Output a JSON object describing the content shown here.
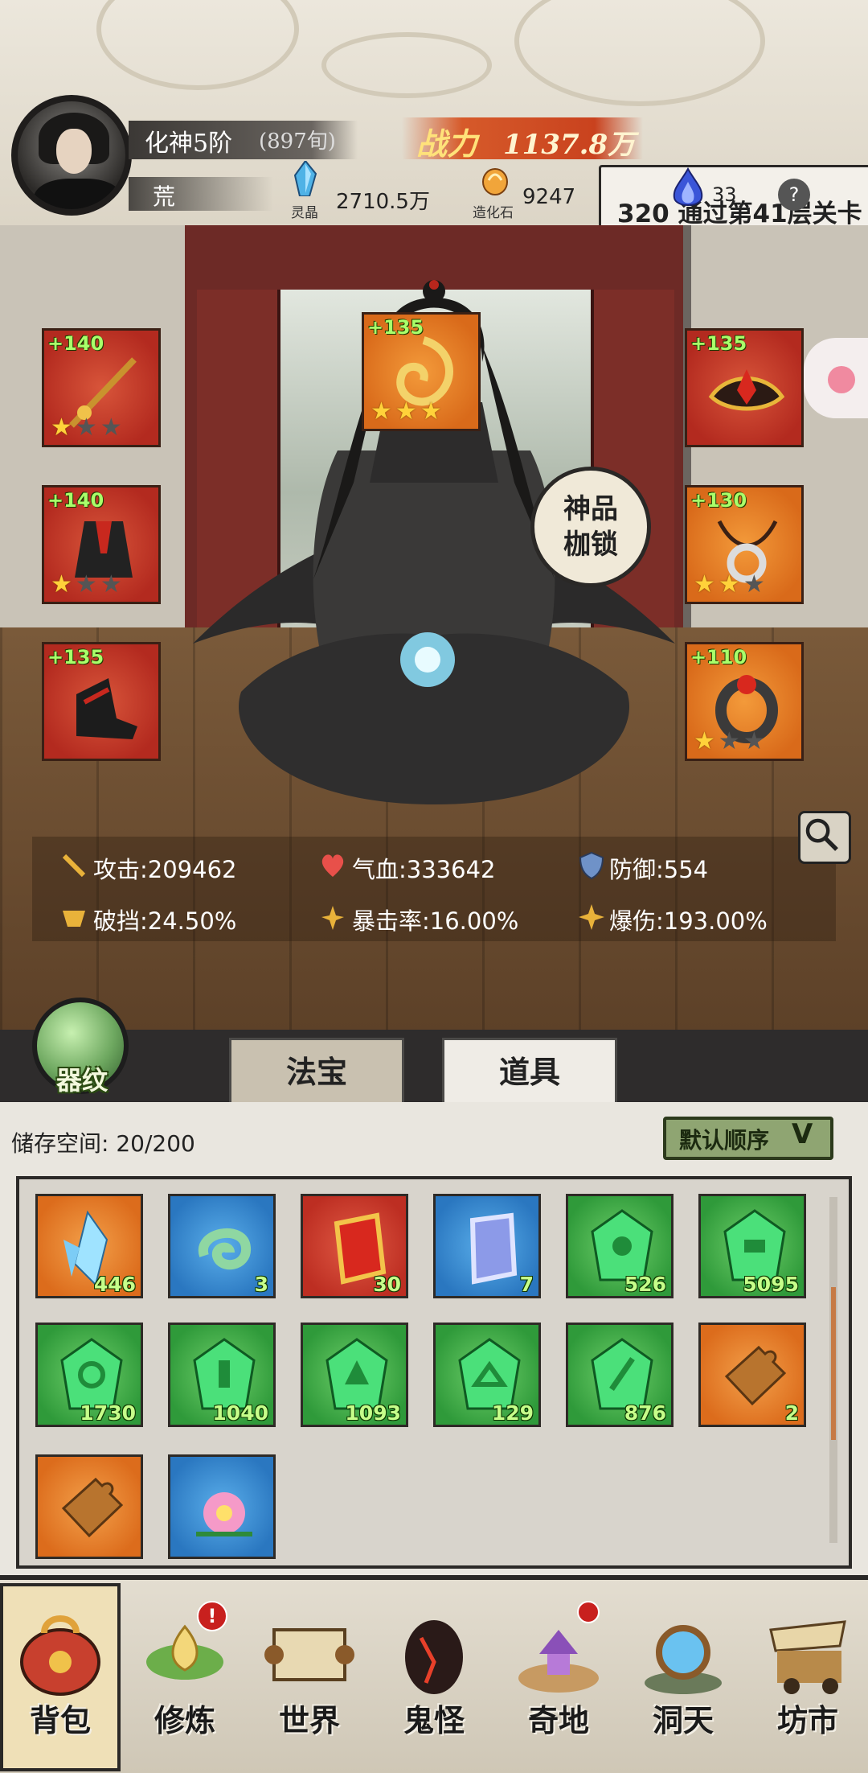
{
  "header": {
    "rank": "化神5阶",
    "rank_sub": "(897旬)",
    "realm": "荒",
    "power_label": "战力",
    "power_value": "1137.8万",
    "currencies": [
      {
        "icon": "spirit-crystal-icon",
        "label": "灵晶",
        "value": "2710.5万"
      },
      {
        "icon": "creation-stone-icon",
        "label": "造化石",
        "value": "9247"
      }
    ],
    "quest": {
      "drop_count": "33",
      "text": "320 通过第41层关卡",
      "bubble": "?"
    }
  },
  "scene": {
    "badge_line1": "神品",
    "badge_line2": "枷锁",
    "equipment": [
      {
        "name": "sword",
        "plus": "+140",
        "stars": 1,
        "max_stars": 3
      },
      {
        "name": "armor",
        "plus": "+140",
        "stars": 1,
        "max_stars": 3
      },
      {
        "name": "boots",
        "plus": "+135",
        "stars": 0,
        "max_stars": 3
      },
      {
        "name": "golden-relic",
        "plus": "+135",
        "stars": 3,
        "max_stars": 3
      },
      {
        "name": "crown",
        "plus": "+135",
        "stars": 0,
        "max_stars": 3
      },
      {
        "name": "pendant",
        "plus": "+130",
        "stars": 2,
        "max_stars": 3
      },
      {
        "name": "ring",
        "plus": "+110",
        "stars": 1,
        "max_stars": 3
      }
    ],
    "stats": [
      {
        "label": "攻击:",
        "value": "209462"
      },
      {
        "label": "气血:",
        "value": "333642"
      },
      {
        "label": "防御:",
        "value": "554"
      },
      {
        "label": "破挡:",
        "value": "24.50%"
      },
      {
        "label": "暴击率:",
        "value": "16.00%"
      },
      {
        "label": "爆伤:",
        "value": "193.00%"
      }
    ]
  },
  "tabs": {
    "gem": "器纹",
    "fabao": "法宝",
    "daoju": "道具"
  },
  "inventory": {
    "storage_label": "储存空间:",
    "storage_value": "20/200",
    "sort_label": "默认顺序",
    "items": [
      {
        "name": "crystal-shards",
        "color": "orange",
        "count": "446"
      },
      {
        "name": "jade-swirl",
        "color": "blue",
        "count": "3"
      },
      {
        "name": "red-talisman",
        "color": "red",
        "count": "30"
      },
      {
        "name": "blue-talisman",
        "color": "blue",
        "count": "7"
      },
      {
        "name": "green-gem",
        "color": "green",
        "count": "526"
      },
      {
        "name": "green-gem",
        "color": "green",
        "count": "5095"
      },
      {
        "name": "green-gem",
        "color": "green",
        "count": "1730"
      },
      {
        "name": "green-gem",
        "color": "green",
        "count": "1040"
      },
      {
        "name": "green-gem",
        "color": "green",
        "count": "1093"
      },
      {
        "name": "green-gem",
        "color": "green",
        "count": "129"
      },
      {
        "name": "green-gem",
        "color": "green",
        "count": "876"
      },
      {
        "name": "puzzle-piece",
        "color": "orange",
        "count": "2"
      },
      {
        "name": "puzzle-piece",
        "color": "orange",
        "count": ""
      },
      {
        "name": "pink-flower",
        "color": "blue",
        "count": ""
      }
    ]
  },
  "nav": [
    {
      "label": "背包",
      "icon": "bag-icon"
    },
    {
      "label": "修炼",
      "icon": "lotus-icon",
      "alert": "!"
    },
    {
      "label": "世界",
      "icon": "scroll-map-icon"
    },
    {
      "label": "鬼怪",
      "icon": "demon-egg-icon"
    },
    {
      "label": "奇地",
      "icon": "pagoda-icon",
      "dot": true
    },
    {
      "label": "洞天",
      "icon": "portal-icon"
    },
    {
      "label": "坊市",
      "icon": "market-cart-icon"
    }
  ]
}
